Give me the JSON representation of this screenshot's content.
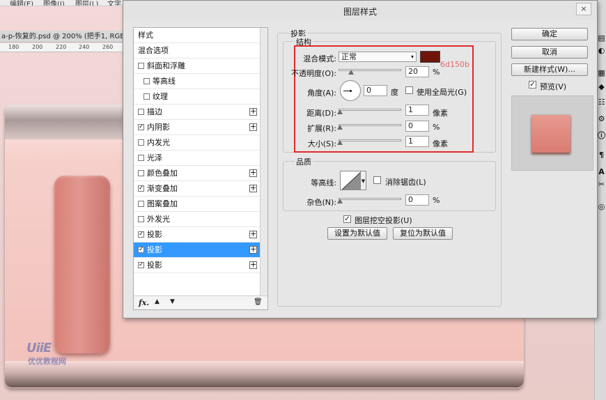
{
  "workspace": {
    "menu": [
      "编辑(E)",
      "图像(I)",
      "图层(L)",
      "文字"
    ],
    "doc_tab": "a-p-恢复的.psd @ 200% (把手1, RGB/",
    "ruler_ticks": [
      "180",
      "200",
      "220",
      "240",
      "260"
    ],
    "watermark_logo": "UiiE",
    "watermark_text": "优优教程网"
  },
  "dialog": {
    "title": "图层样式",
    "close_label": "×"
  },
  "style_list": {
    "items": [
      {
        "label": "样式",
        "checkbox": false,
        "checked": false,
        "plus": false,
        "indent": 0,
        "selected": false
      },
      {
        "label": "混合选项",
        "checkbox": false,
        "checked": false,
        "plus": false,
        "indent": 0,
        "selected": false
      },
      {
        "label": "斜面和浮雕",
        "checkbox": true,
        "checked": false,
        "plus": false,
        "indent": 0,
        "selected": false
      },
      {
        "label": "等高线",
        "checkbox": true,
        "checked": false,
        "plus": false,
        "indent": 1,
        "selected": false
      },
      {
        "label": "纹理",
        "checkbox": true,
        "checked": false,
        "plus": false,
        "indent": 1,
        "selected": false
      },
      {
        "label": "描边",
        "checkbox": true,
        "checked": false,
        "plus": true,
        "indent": 0,
        "selected": false
      },
      {
        "label": "内阴影",
        "checkbox": true,
        "checked": true,
        "plus": true,
        "indent": 0,
        "selected": false
      },
      {
        "label": "内发光",
        "checkbox": true,
        "checked": false,
        "plus": false,
        "indent": 0,
        "selected": false
      },
      {
        "label": "光泽",
        "checkbox": true,
        "checked": false,
        "plus": false,
        "indent": 0,
        "selected": false
      },
      {
        "label": "颜色叠加",
        "checkbox": true,
        "checked": false,
        "plus": true,
        "indent": 0,
        "selected": false
      },
      {
        "label": "渐变叠加",
        "checkbox": true,
        "checked": true,
        "plus": true,
        "indent": 0,
        "selected": false
      },
      {
        "label": "图案叠加",
        "checkbox": true,
        "checked": false,
        "plus": false,
        "indent": 0,
        "selected": false
      },
      {
        "label": "外发光",
        "checkbox": true,
        "checked": false,
        "plus": false,
        "indent": 0,
        "selected": false
      },
      {
        "label": "投影",
        "checkbox": true,
        "checked": true,
        "plus": true,
        "indent": 0,
        "selected": false
      },
      {
        "label": "投影",
        "checkbox": true,
        "checked": true,
        "plus": true,
        "indent": 0,
        "selected": true
      },
      {
        "label": "投影",
        "checkbox": true,
        "checked": true,
        "plus": true,
        "indent": 0,
        "selected": false
      }
    ],
    "footer": {
      "fx": "fx.",
      "up": "▲",
      "down": "▼",
      "trash": "🗑"
    }
  },
  "panel": {
    "group_title": "投影",
    "structure_title": "结构",
    "blend_mode_label": "混合模式:",
    "blend_mode_value": "正常",
    "shadow_color": "#6d150b",
    "color_note": "6d150b",
    "opacity_label": "不透明度(O):",
    "opacity_value": "20",
    "opacity_fraction": 0.2,
    "opacity_unit": "%",
    "angle_label": "角度(A):",
    "angle_value": "0",
    "angle_unit": "度",
    "global_light_label": "使用全局光(G)",
    "global_light_checked": false,
    "distance_label": "距离(D):",
    "distance_value": "1",
    "distance_unit": "像素",
    "spread_label": "扩展(R):",
    "spread_value": "0",
    "spread_unit": "%",
    "size_label": "大小(S):",
    "size_value": "1",
    "size_unit": "像素",
    "quality_title": "品质",
    "contour_label": "等高线:",
    "antialias_label": "消除锯齿(L)",
    "antialias_checked": false,
    "noise_label": "杂色(N):",
    "noise_value": "0",
    "noise_unit": "%",
    "knockout_label": "图层挖空投影(U)",
    "knockout_checked": true,
    "make_default": "设置为默认值",
    "reset_default": "复位为默认值"
  },
  "actions": {
    "ok": "确定",
    "cancel": "取消",
    "new_style": "新建样式(W)...",
    "preview_label": "预览(V)",
    "preview_checked": true
  }
}
